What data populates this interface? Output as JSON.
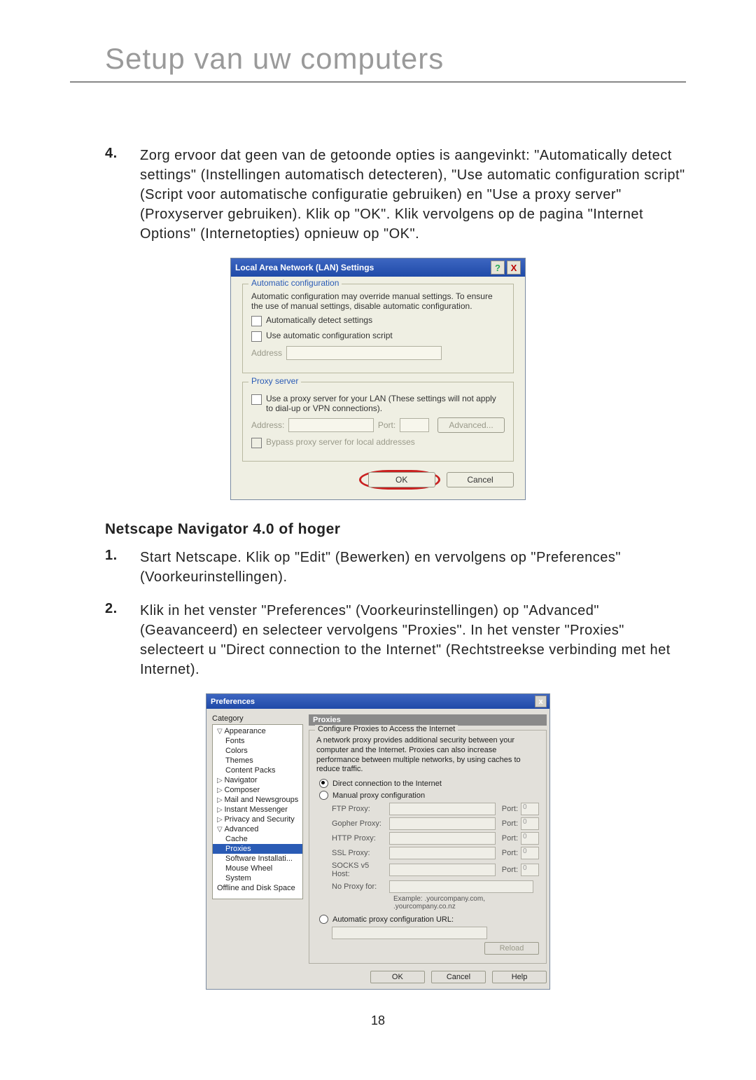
{
  "page_title": "Setup van uw computers",
  "page_number": "18",
  "step4": {
    "num": "4.",
    "text": "Zorg ervoor dat geen van de getoonde opties is aangevinkt: \"Automatically detect settings\" (Instellingen automatisch detecteren), \"Use automatic configuration script\" (Script voor automatische configuratie gebruiken) en \"Use a proxy server\" (Proxyserver gebruiken). Klik op \"OK\". Klik vervolgens op de pagina \"Internet Options\" (Internetopties) opnieuw op \"OK\"."
  },
  "lan": {
    "title": "Local Area Network (LAN) Settings",
    "help": "?",
    "close": "X",
    "grp1_legend": "Automatic configuration",
    "grp1_desc": "Automatic configuration may override manual settings.  To ensure the use of manual settings, disable automatic configuration.",
    "chk_auto_detect": "Automatically detect settings",
    "chk_auto_script": "Use automatic configuration script",
    "addr_label": "Address",
    "grp2_legend": "Proxy server",
    "chk_proxy": "Use a proxy server for your LAN (These settings will not apply to dial-up or VPN connections).",
    "addr2_label": "Address:",
    "port_label": "Port:",
    "advanced": "Advanced...",
    "chk_bypass": "Bypass proxy server for local addresses",
    "ok": "OK",
    "cancel": "Cancel"
  },
  "subhead_netscape": "Netscape Navigator 4.0 of hoger",
  "ns_step1": {
    "num": "1.",
    "text": "Start Netscape. Klik op \"Edit\" (Bewerken) en vervolgens op \"Preferences\" (Voorkeurinstellingen)."
  },
  "ns_step2": {
    "num": "2.",
    "text": "Klik in het venster \"Preferences\" (Voorkeurinstellingen) op \"Advanced\" (Geavanceerd) en selecteer vervolgens \"Proxies\". In het venster \"Proxies\" selecteert u \"Direct connection to the Internet\" (Rechtstreekse verbinding met het Internet)."
  },
  "ns": {
    "title": "Preferences",
    "close": "x",
    "category_label": "Category",
    "tree": {
      "appearance": "Appearance",
      "fonts": "Fonts",
      "colors": "Colors",
      "themes": "Themes",
      "content_packs": "Content Packs",
      "navigator": "Navigator",
      "composer": "Composer",
      "mail": "Mail and Newsgroups",
      "im": "Instant Messenger",
      "privacy": "Privacy and Security",
      "advanced": "Advanced",
      "cache": "Cache",
      "proxies": "Proxies",
      "software": "Software Installati...",
      "mouse": "Mouse Wheel",
      "system": "System",
      "offline": "Offline and Disk Space"
    },
    "main_header": "Proxies",
    "grp_legend": "Configure Proxies to Access the Internet",
    "grp_desc": "A network proxy provides additional security between your computer and the Internet. Proxies can also increase performance between multiple networks, by using caches to reduce traffic.",
    "r_direct": "Direct connection to the Internet",
    "r_manual": "Manual proxy configuration",
    "ftp": "FTP Proxy:",
    "gopher": "Gopher Proxy:",
    "http": "HTTP Proxy:",
    "ssl": "SSL Proxy:",
    "socks": "SOCKS v5 Host:",
    "noproxy": "No Proxy for:",
    "port": "Port:",
    "port_default": "0",
    "example": "Example: .yourcompany.com, .yourcompany.co.nz",
    "r_auto": "Automatic proxy configuration URL:",
    "reload": "Reload",
    "ok": "OK",
    "cancel": "Cancel",
    "help": "Help"
  }
}
